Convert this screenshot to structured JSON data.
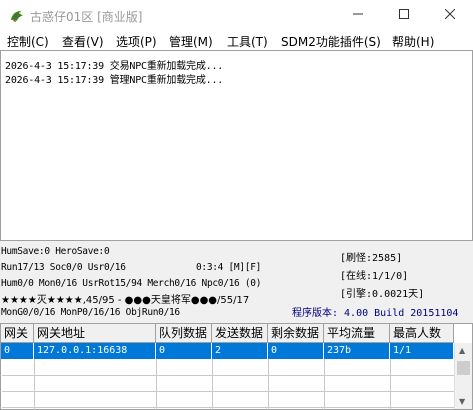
{
  "window": {
    "title": "古惑仔01区 [商业版]",
    "icons": {
      "app": "dragon-app-icon",
      "minimize": "minimize-icon",
      "maximize": "maximize-icon",
      "close": "close-icon"
    }
  },
  "menu": [
    {
      "label": "控制(C)"
    },
    {
      "label": "查看(V)"
    },
    {
      "label": "选项(P)"
    },
    {
      "label": "管理(M)"
    },
    {
      "label": "工具(T)"
    },
    {
      "label": "SDM2功能插件(S)"
    },
    {
      "label": "帮助(H)"
    }
  ],
  "log": [
    "2026-4-3 15:17:39 交易NPC重新加载完成...",
    "2026-4-3 15:17:39 管理NPC重新加载完成..."
  ],
  "stats": {
    "line1": "HumSave:0 HeroSave:0",
    "line2": "Run17/13 Soc0/0 Usr0/16",
    "time": "0:3:4 [M][F]",
    "line3": "Hum0/0 Mon0/16 UsrRot15/94 Merch0/16 Npc0/16 (0)",
    "line4": "★★★★灭★★★★,45/95 - ●●●天皇将军●●●/55/17",
    "line5": "MonG0/0/16 MonP0/16/16 ObjRun0/16",
    "refresh": "[刷怪:2585]",
    "online": "[在线:1/1/0]",
    "engine": "[引擎:0.0021天]",
    "version": "程序版本: 4.00 Build 20151104"
  },
  "gateways": {
    "headers": [
      "网关",
      "网关地址",
      "队列数据",
      "发送数据",
      "剩余数据",
      "平均流量",
      "最高人数"
    ],
    "rows": [
      [
        "0",
        "127.0.0.1:16638",
        "0",
        "2",
        "0",
        "237b",
        "1/1"
      ]
    ],
    "selected_row_color": "#0078d7"
  }
}
